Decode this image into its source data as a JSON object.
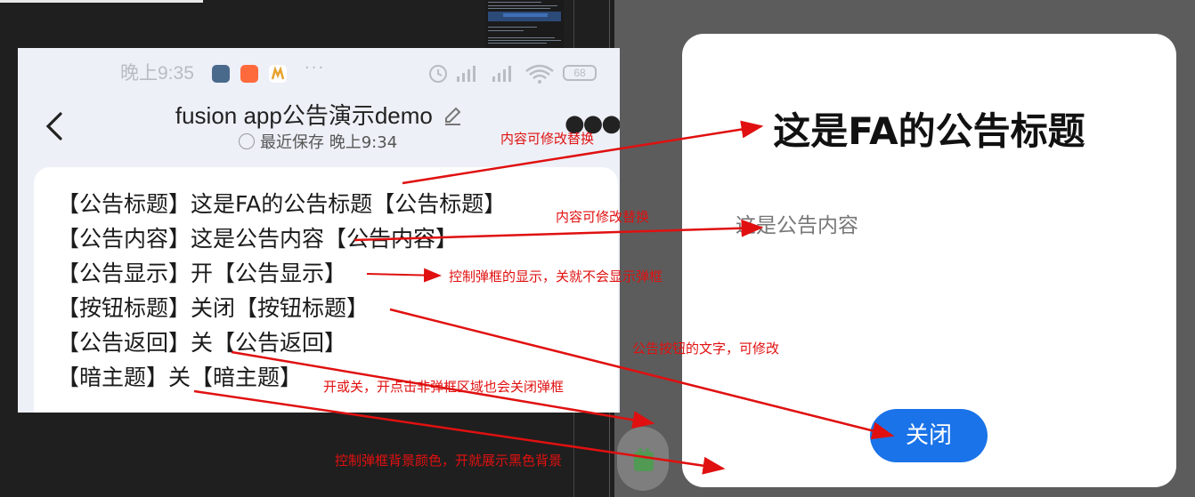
{
  "phone": {
    "status_time": "晚上9:35",
    "status_more": "···",
    "battery": "68",
    "doc_title": "fusion app公告演示demo",
    "saved_status": "最近保存 晚上9:34",
    "lines": [
      "【公告标题】这是FA的公告标题【公告标题】",
      "【公告内容】这是公告内容【公告内容】",
      "【公告显示】开【公告显示】",
      "【按钮标题】关闭【按钮标题】",
      "【公告返回】关【公告返回】",
      "【暗主题】关【暗主题】"
    ]
  },
  "dialog": {
    "title": "这是FA的公告标题",
    "content": "这是公告内容",
    "button_label": "关闭"
  },
  "annotations": {
    "a1": "内容可修改替换",
    "a2": "内容可修改替换",
    "a3": "控制弹框的显示，关就不会显示弹框",
    "a4": "公告按钮的文字，可修改",
    "a5": "开或关，开点击非弹框区域也会关闭弹框",
    "a6": "控制弹框背景颜色，开就展示黑色背景"
  },
  "colors": {
    "annotation": "#e01010",
    "button": "#1a73e8",
    "dim_background": "#5c5c5c"
  }
}
